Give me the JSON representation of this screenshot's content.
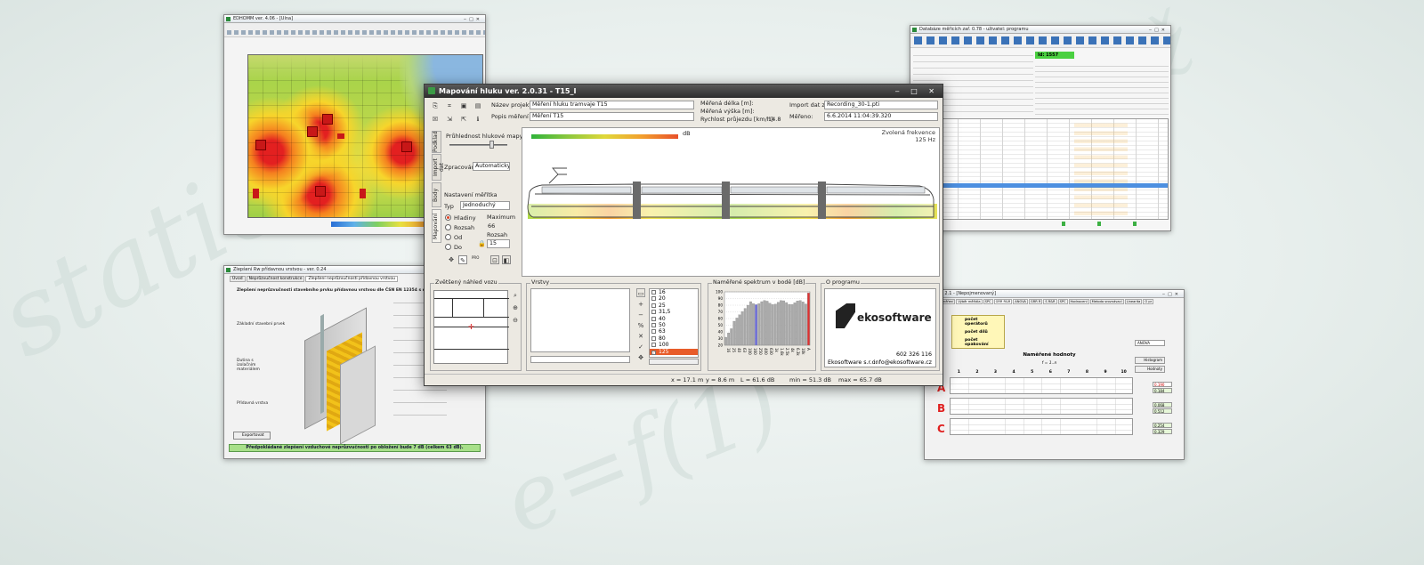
{
  "colors": {
    "accent_green": "#2f8f3a",
    "tram_heat_red": "#e0402a",
    "orange_sel": "#e85c2a"
  },
  "main_window": {
    "title": "Mapování hluku ver. 2.0.31  -  T15_I",
    "controls": "‒ □ ✕",
    "fields": {
      "nazev_label": "Název projektu",
      "nazev_value": "Měření hluku tramvaje T15",
      "popis_label": "Popis měření",
      "popis_value": "Měření T15",
      "delka_label": "Měřená délka [m]:",
      "vyska_label": "Měřená výška [m]:",
      "rychlost_label": "Rychlost průjezdu [km/h]:",
      "rychlost_value": "14.8",
      "import_label": "Import dat z:",
      "import_value": "Recording_30-1.pti",
      "mereno_label": "Měřeno:",
      "mereno_value": "6.6.2014  11:04:39.320"
    },
    "side_tabs": [
      "Mapování",
      "Body",
      "Import dat",
      "Podklad"
    ],
    "left_panel": {
      "pruhlednost": "Průhlednost hlukové mapy",
      "zpracovani_label": "Zpracování",
      "zpracovani_value": "Automaticky",
      "nastaveni": "Nastavení měřítka",
      "typ_label": "Typ",
      "typ_value": "Jednoduchý",
      "radios": [
        "Hladiny",
        "Rozsah",
        "Od",
        "Do"
      ],
      "maximum_label": "Maximum",
      "maximum_value": "66",
      "rozsah_label": "Rozsah",
      "rozsah_value": "15",
      "tool_label": "PRO"
    },
    "map": {
      "db_label": "dB",
      "freq_title": "Zvolená frekvence",
      "freq_value": "125 Hz"
    },
    "panels": {
      "detail_title": "Zvětšený náhled vozu",
      "vrstvy_title": "Vrstvy",
      "freqs": [
        "16",
        "20",
        "25",
        "31,5",
        "40",
        "50",
        "63",
        "80",
        "100",
        "125"
      ],
      "spektrum_title": "Naměřené spektrum v bodě  [dB]",
      "spektrum_yticks": [
        "100",
        "90",
        "80",
        "70",
        "60",
        "50",
        "40",
        "30",
        "20"
      ],
      "spektrum_xticks": [
        "16",
        "25",
        "40",
        "63",
        "100",
        "160",
        "250",
        "400",
        "630",
        "1k",
        "1.6k",
        "2.5k",
        "4k",
        "6.3k",
        "10k",
        "A"
      ],
      "program_title": "O programu",
      "logo_text": "ekosoftware",
      "phone": "602 326 116",
      "company": "Ekosoftware s.r.o.",
      "email": "info@ekosoftware.cz"
    },
    "status": {
      "x": "x = 17.1 m",
      "y": "y = 8.6 m",
      "l": "L = 61.6 dB",
      "min": "min = 51.3 dB",
      "max": "max = 65.7 dB"
    }
  },
  "bg_windows": {
    "topleft": {
      "title": "EDHOMM ver. 4.06 - [Ulna]"
    },
    "bottomleft": {
      "title": "Zlepšení Rw přídavnou vrstvou - ver. 0.24",
      "tabs": [
        "Úvod",
        "Neprůzvučnost konstrukce",
        "Zlepšení neprůzvučnosti přídavnou vrstvou"
      ],
      "heading": "Zlepšení neprůzvučnosti stavebního prvku přídavnou vrstvou dle ČSN EN 12354 s dutinou vzduchu",
      "labels": [
        "Základní stavební prvek",
        "Dutina s izolačním materiálem",
        "Přídavná vrstva"
      ],
      "export": "Exportovat",
      "result": "Předpokládané zlepšení vzduchové neprůzvučnosti po obložení bude 7 dB (celkem 63 dB)."
    },
    "topright": {
      "title": "Databáze měřicích zař. 0.78 - uživatel: programu",
      "id_badge": "Id: 1557"
    },
    "bottomright": {
      "title": "R&R 2.1 - [Nepojmenovaný]",
      "tabs": [
        "Vstupní měření",
        "Výběr měřidla",
        "SPC",
        "GRR R&R",
        "ANOVA",
        "GRR R",
        "S R&R",
        "SPC",
        "Hodnocení",
        "Metoda srovnávací",
        "Linearita",
        "O pr"
      ],
      "btns": [
        "počet operátorů",
        "počet dílů",
        "počet opakování"
      ],
      "anova": "ANOVA",
      "table_title": "Naměřené hodnoty",
      "table_sub": "f = 1..n",
      "hist_btn": "Histogram",
      "hodnoty_btn": "Hodnoty",
      "groups": [
        "A",
        "B",
        "C"
      ],
      "cols": [
        "1",
        "2",
        "3",
        "4",
        "5",
        "6",
        "7",
        "8",
        "9",
        "10"
      ],
      "side_vals": [
        "0.190",
        "0.184",
        "0.068",
        "0.512",
        "0.254",
        "0.329"
      ]
    }
  }
}
